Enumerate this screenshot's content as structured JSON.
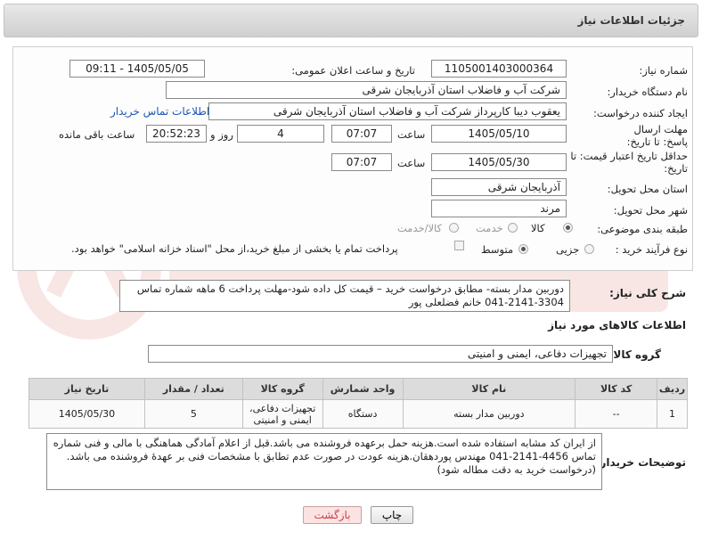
{
  "header": {
    "title": "جزئیات اطلاعات نیاز"
  },
  "form": {
    "need_number_label": "شماره نیاز:",
    "need_number": "1105001403000364",
    "announce_label": "تاریخ و ساعت اعلان عمومی:",
    "announce_value": "1405/05/05 - 09:11",
    "buyer_org_label": "نام دستگاه خریدار:",
    "buyer_org": "شرکت آب و فاضلاب استان آذربایجان شرقی",
    "requester_label": "ایجاد کننده درخواست:",
    "requester": "یعقوب دیبا کارپرداز شرکت آب و فاضلاب استان آذربایجان شرقی",
    "contact_link": "اطلاعات تماس خریدار",
    "reply_deadline_label": "مهلت ارسال پاسخ: تا تاریخ:",
    "reply_date": "1405/05/10",
    "time_label": "ساعت",
    "reply_time": "07:07",
    "days_value": "4",
    "days_label": "روز و",
    "remaining_time": "20:52:23",
    "remaining_label": "ساعت باقی مانده",
    "price_validity_label": "حداقل تاریخ اعتبار قیمت: تا تاریخ:",
    "validity_date": "1405/05/30",
    "validity_time": "07:07",
    "province_label": "استان محل تحویل:",
    "province": "آذربایجان شرقی",
    "city_label": "شهر محل تحویل:",
    "city": "مرند",
    "category_label": "طبقه بندی موضوعی:",
    "category_options": [
      "کالا",
      "خدمت",
      "کالا/خدمت"
    ],
    "process_label": "نوع فرآیند خرید :",
    "process_options": [
      "جزیی",
      "متوسط"
    ],
    "payment_note": "پرداخت تمام یا بخشی از مبلغ خرید،از محل \"اسناد خزانه اسلامی\" خواهد بود."
  },
  "description": {
    "label": "شرح کلی نیاز:",
    "text": "دوربین مدار بسته- مطابق درخواست خرید – قیمت کل داده شود-مهلت پرداخت 6 ماهه  شماره تماس 3304-2141-041 خانم فضلعلی پور"
  },
  "goods": {
    "section_title": "اطلاعات کالاهای مورد نیاز",
    "group_label": "گروه کالا:",
    "group_value": "تجهیزات دفاعی، ایمنی و امنیتی",
    "columns": [
      "ردیف",
      "کد کالا",
      "نام کالا",
      "واحد شمارش",
      "گروه کالا",
      "تعداد / مقدار",
      "تاریخ نیاز"
    ],
    "rows": [
      {
        "row": "1",
        "code": "--",
        "name": "دوربین مدار بسته",
        "unit": "دستگاه",
        "group_line1": "تجهیزات دفاعی،",
        "group_line2": "ایمنی و امنیتی",
        "qty": "5",
        "date": "1405/05/30"
      }
    ]
  },
  "buyer_notes": {
    "label": "توضیحات خریدار:",
    "text": "از ایران کد مشابه استفاده شده است.هزینه حمل برعهده فروشنده می باشد.قبل از اعلام آمادگی هماهنگی با مالی و فنی شماره تماس 4456-2141-041 مهندس پوردهقان.هزینه عودت در صورت عدم تطابق با مشخصات فنی بر عهدهٔ فروشنده می باشد.(درخواست خرید به دقت مطاله شود)"
  },
  "buttons": {
    "print": "چاپ",
    "back": "بازگشت"
  },
  "colors": {
    "link": "#1a56b8",
    "back_button_bg": "#fbe3e3",
    "back_button_text": "#cc4444"
  }
}
